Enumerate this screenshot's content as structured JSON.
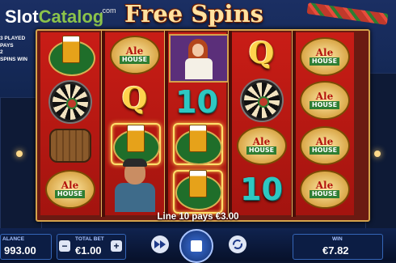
{
  "logo": {
    "part1": "Slot",
    "part2": "Catalog",
    "suffix": ".com"
  },
  "game": {
    "title": "Free Spins"
  },
  "info": {
    "line1": "3 PLAYED",
    "line2": "PAYS",
    "line3": "2",
    "line4": "SPINS WIN"
  },
  "reels": [
    [
      "beer-badge",
      "ale-house",
      "dartboard",
      "barrel",
      "ale-house"
    ],
    [
      "ale-house",
      "Q",
      "beer-mug",
      "drinker"
    ],
    [
      "barmaid",
      "10",
      "beer-mug",
      "beer-mug"
    ],
    [
      "Q",
      "dartboard",
      "ale-house",
      "10"
    ],
    [
      "ale-house",
      "ale-house",
      "dartboard",
      "ale-house",
      "ale-house"
    ]
  ],
  "symbols": {
    "queen": "Q",
    "ten": "10",
    "ale_top": "Ale",
    "ale_bottom": "HOUSE"
  },
  "win_message": "Line 10 pays €3.00",
  "balance": {
    "label": "ALANCE",
    "value": "993.00"
  },
  "total_bet": {
    "label": "TOTAL BET",
    "value": "€1.00",
    "minus": "−",
    "plus": "+"
  },
  "win": {
    "label": "WIN",
    "value": "€7.82"
  },
  "colors": {
    "reel_red": "#c91d16",
    "frame_gold": "#d4a24c",
    "accent_blue": "#3566b8"
  },
  "icons": {
    "fast": "fast-forward-icon",
    "stop": "stop-icon",
    "auto": "autoplay-icon"
  }
}
